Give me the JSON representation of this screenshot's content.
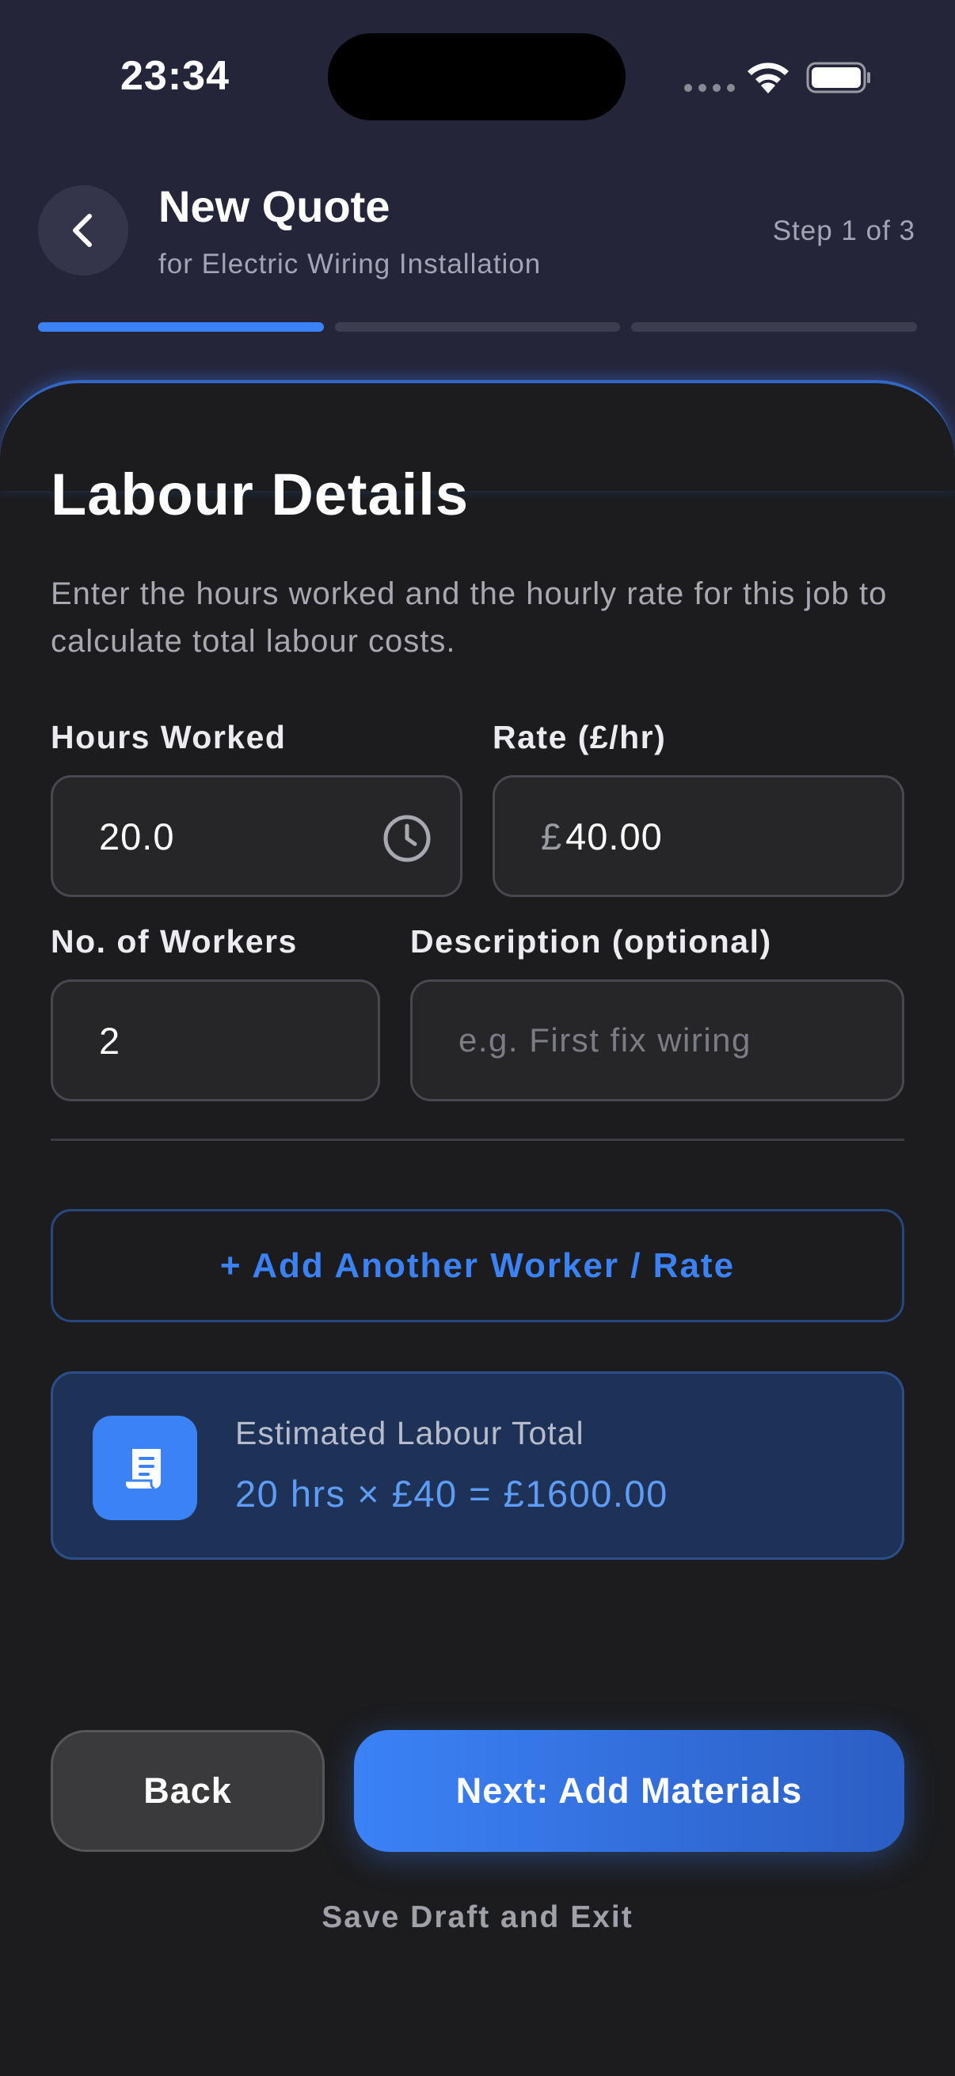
{
  "status_bar": {
    "time": "23:34"
  },
  "header": {
    "title": "New Quote",
    "subtitle": "for Electric Wiring Installation",
    "step_label": "Step 1 of 3",
    "progress": {
      "total_steps": 3,
      "current_step": 1
    }
  },
  "section": {
    "title": "Labour Details",
    "description": "Enter the hours worked and the hourly rate for this job to calculate total labour costs."
  },
  "fields": {
    "hours": {
      "label": "Hours Worked",
      "value": "20.0"
    },
    "rate": {
      "label": "Rate (£/hr)",
      "prefix": "£",
      "value": "40.00"
    },
    "workers": {
      "label": "No. of Workers",
      "value": "2"
    },
    "description": {
      "label": "Description (optional)",
      "placeholder": "e.g. First fix wiring"
    }
  },
  "add_worker_label": "+ Add Another Worker / Rate",
  "estimate": {
    "label": "Estimated Labour Total",
    "value": "20 hrs × £40 = £1600.00"
  },
  "actions": {
    "back_label": "Back",
    "next_label": "Next: Add Materials",
    "save_draft_label": "Save Draft and Exit"
  },
  "colors": {
    "accent": "#3b82f6",
    "background": "#25253a",
    "card": "#1c1c1e"
  }
}
